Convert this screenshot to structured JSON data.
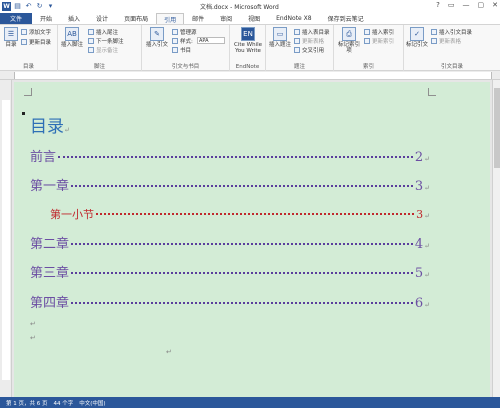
{
  "window": {
    "title": "文档.docx - Microsoft Word",
    "controls": [
      "?",
      "▭",
      "—",
      "▢",
      "✕"
    ]
  },
  "quick_access": {
    "logo": "W",
    "items": [
      "save-icon",
      "undo-icon",
      "redo-icon",
      "customize-icon"
    ]
  },
  "tabs": [
    "文件",
    "开始",
    "插入",
    "设计",
    "页面布局",
    "引用",
    "邮件",
    "审阅",
    "视图",
    "EndNote X8",
    "保存到云笔记"
  ],
  "active_tab": "引用",
  "ribbon": {
    "groups": [
      {
        "label": "目录",
        "big_button": "目录",
        "small_buttons": [
          "添加文字",
          "更新目录"
        ]
      },
      {
        "label": "脚注",
        "big_button": "插入脚注",
        "small_buttons": [
          "插入尾注",
          "下一条脚注",
          "显示备注"
        ]
      },
      {
        "label": "引文与书目",
        "big_button": "插入引文",
        "small_buttons": [
          "管理源",
          "样式:",
          "书目"
        ],
        "style_value": "APA"
      },
      {
        "label": "EndNote",
        "big_button": "Cite While You Write"
      },
      {
        "label": "题注",
        "big_button": "插入题注",
        "small_buttons": [
          "插入表目录",
          "更新表格",
          "交叉引用"
        ]
      },
      {
        "label": "索引",
        "big_button": "标记索引项",
        "small_buttons": [
          "插入索引",
          "更新索引"
        ]
      },
      {
        "label": "引文目录",
        "big_button": "标记引文",
        "small_buttons": [
          "插入引文目录",
          "更新表格"
        ]
      }
    ]
  },
  "document": {
    "toc_title": "目录",
    "para_mark": "↵",
    "entries": [
      {
        "label": "前言",
        "page": "2",
        "level": 1
      },
      {
        "label": "第一章",
        "page": "3",
        "level": 1
      },
      {
        "label": "第一小节",
        "page": "3",
        "level": 2
      },
      {
        "label": "第二章",
        "page": "4",
        "level": 1
      },
      {
        "label": "第三章",
        "page": "5",
        "level": 1
      },
      {
        "label": "第四章",
        "page": "6",
        "level": 1
      }
    ]
  },
  "status": {
    "page": "第 1 页，共 6 页",
    "words": "44 个字",
    "language": "中文(中国)"
  }
}
